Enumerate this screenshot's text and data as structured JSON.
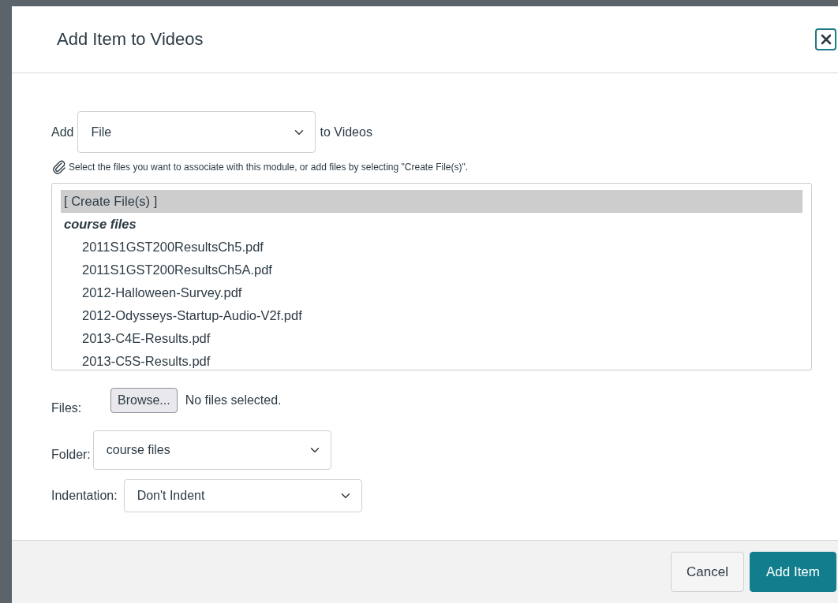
{
  "dialog": {
    "title": "Add Item to Videos"
  },
  "add_row": {
    "prefix": "Add",
    "type_value": "File",
    "suffix": "to Videos"
  },
  "hint": "Select the files you want to associate with this module, or add files by selecting \"Create File(s)\".",
  "file_list": {
    "items": [
      {
        "kind": "action",
        "label": "[ Create File(s) ]",
        "selected": true
      },
      {
        "kind": "group",
        "label": "course files",
        "selected": false,
        "children": [
          {
            "label": "2011S1GST200ResultsCh5.pdf",
            "selected": false
          },
          {
            "label": "2011S1GST200ResultsCh5A.pdf",
            "selected": false
          },
          {
            "label": "2012-Halloween-Survey.pdf",
            "selected": false
          },
          {
            "label": "2012-Odysseys-Startup-Audio-V2f.pdf",
            "selected": false
          },
          {
            "label": "2013-C4E-Results.pdf",
            "selected": false
          },
          {
            "label": "2013-C5S-Results.pdf",
            "selected": false
          }
        ]
      }
    ]
  },
  "files": {
    "label": "Files:",
    "button": "Browse...",
    "status": "No files selected."
  },
  "folder": {
    "label": "Folder:",
    "value": "course files"
  },
  "indentation": {
    "label": "Indentation:",
    "value": "Don't Indent"
  },
  "buttons": [
    {
      "label": "Cancel",
      "kind": "secondary"
    },
    {
      "label": "Add Item",
      "kind": "primary"
    }
  ]
}
